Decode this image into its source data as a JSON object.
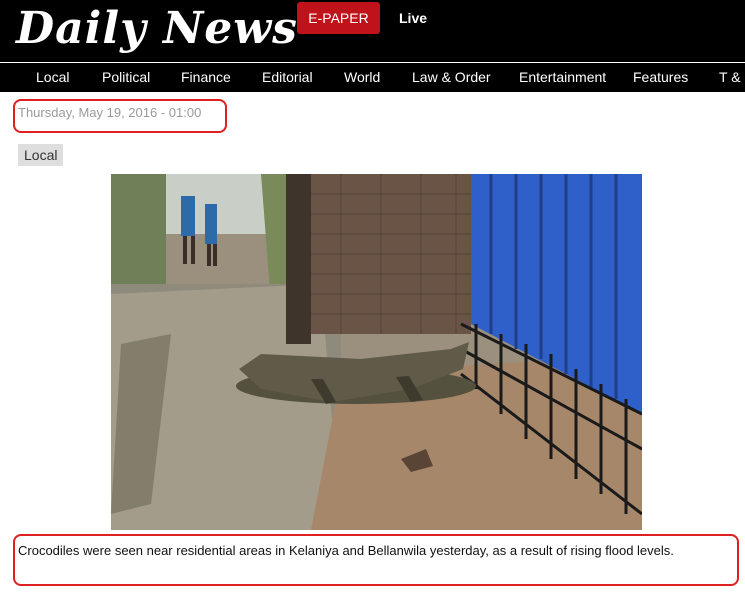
{
  "header": {
    "logo_text": "Daily News",
    "epaper_label": "E-PAPER",
    "live_label": "Live",
    "colors": {
      "background": "#000000",
      "epaper": "#c0121a"
    }
  },
  "nav": {
    "items": [
      "Local",
      "Political",
      "Finance",
      "Editorial",
      "World",
      "Law & Order",
      "Entertainment",
      "Features",
      "T & C"
    ]
  },
  "article": {
    "date": "Thursday, May 19, 2016 - 01:00",
    "category": "Local",
    "image_icon": "photo-crocodile-flooded-street",
    "caption": "Crocodiles were seen near residential areas in Kelaniya and Bellanwila yesterday, as a result of rising flood levels."
  },
  "highlight_color": "#e02020"
}
